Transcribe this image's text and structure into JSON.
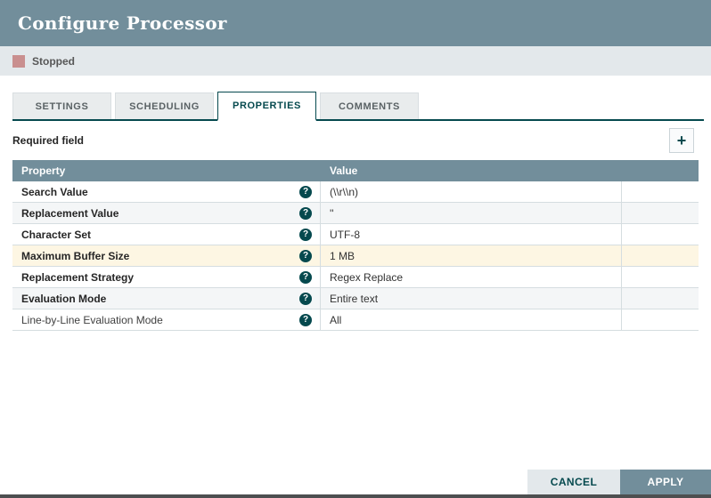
{
  "dialog": {
    "title": "Configure Processor"
  },
  "status": {
    "label": "Stopped",
    "color": "#c98f8f"
  },
  "tabs": [
    {
      "label": "SETTINGS",
      "active": false
    },
    {
      "label": "SCHEDULING",
      "active": false
    },
    {
      "label": "PROPERTIES",
      "active": true
    },
    {
      "label": "COMMENTS",
      "active": false
    }
  ],
  "toolbar": {
    "required_label": "Required field"
  },
  "icons": {
    "add": "+",
    "help": "?"
  },
  "table": {
    "columns": [
      "Property",
      "Value"
    ],
    "rows": [
      {
        "property": "Search Value",
        "value": "(\\\\r\\\\n)",
        "required": true,
        "highlighted": false
      },
      {
        "property": "Replacement Value",
        "value": "''",
        "required": true,
        "highlighted": false
      },
      {
        "property": "Character Set",
        "value": "UTF-8",
        "required": true,
        "highlighted": false
      },
      {
        "property": "Maximum Buffer Size",
        "value": "1 MB",
        "required": true,
        "highlighted": true
      },
      {
        "property": "Replacement Strategy",
        "value": "Regex Replace",
        "required": true,
        "highlighted": false
      },
      {
        "property": "Evaluation Mode",
        "value": "Entire text",
        "required": true,
        "highlighted": false
      },
      {
        "property": "Line-by-Line Evaluation Mode",
        "value": "All",
        "required": false,
        "highlighted": false
      }
    ]
  },
  "footer": {
    "cancel_label": "CANCEL",
    "apply_label": "APPLY"
  },
  "colors": {
    "accent": "#728e9b",
    "teal": "#05494e",
    "highlight_row": "#fdf6e3",
    "status_bar": "#e3e8eb"
  }
}
